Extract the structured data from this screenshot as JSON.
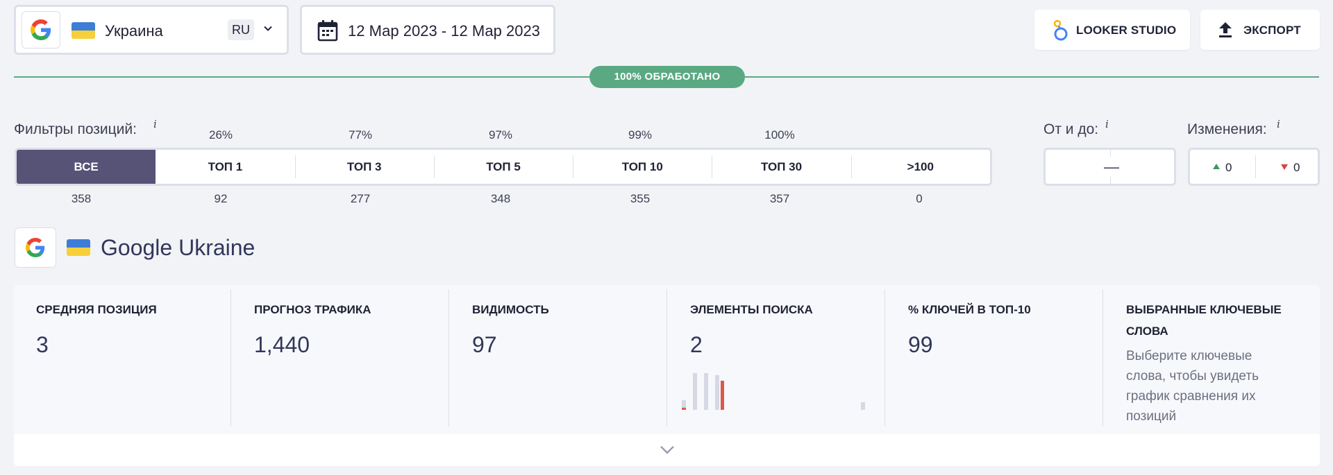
{
  "toolbar": {
    "country": "Украина",
    "language": "RU",
    "date_range": "12 Мар 2023 - 12 Мар 2023",
    "looker_label": "LOOKER STUDIO",
    "export_label": "ЭКСПОРТ",
    "progress_label": "100% ОБРАБОТАНО",
    "progress_percent": 100
  },
  "filters": {
    "title": "Фильтры позиций:",
    "info": "i",
    "segments": [
      {
        "label": "ВСЕ",
        "percent": "",
        "count": "358",
        "active": true
      },
      {
        "label": "ТОП 1",
        "percent": "26%",
        "count": "92",
        "active": false
      },
      {
        "label": "ТОП 3",
        "percent": "77%",
        "count": "277",
        "active": false
      },
      {
        "label": "ТОП 5",
        "percent": "97%",
        "count": "348",
        "active": false
      },
      {
        "label": "ТОП 10",
        "percent": "99%",
        "count": "355",
        "active": false
      },
      {
        "label": "ТОП 30",
        "percent": "100%",
        "count": "357",
        "active": false
      },
      {
        "label": ">100",
        "percent": "",
        "count": "0",
        "active": false
      }
    ],
    "range_title": "От и до:",
    "range_dash": "—",
    "changes_title": "Изменения:",
    "changes_up": "0",
    "changes_down": "0"
  },
  "engine": {
    "title": "Google Ukraine"
  },
  "metrics": [
    {
      "label": "СРЕДНЯЯ ПОЗИЦИЯ",
      "value": "3"
    },
    {
      "label": "ПРОГНОЗ ТРАФИКА",
      "value": "1,440"
    },
    {
      "label": "ВИДИМОСТЬ",
      "value": "97"
    },
    {
      "label": "ЭЛЕМЕНТЫ ПОИСКА",
      "value": "2"
    },
    {
      "label": "% КЛЮЧЕЙ В ТОП-10",
      "value": "99"
    },
    {
      "label": "ВЫБРАННЫЕ КЛЮЧЕВЫЕ СЛОВА",
      "hint": "Выберите ключевые слова, чтобы увидеть график сравнения их позиций"
    }
  ],
  "colors": {
    "active_filter": "#575377",
    "progress": "#5aa982",
    "up": "#3a9a5b",
    "down": "#d64545",
    "bar_gray": "#d6d8e3",
    "bar_red": "#d95a4a"
  }
}
